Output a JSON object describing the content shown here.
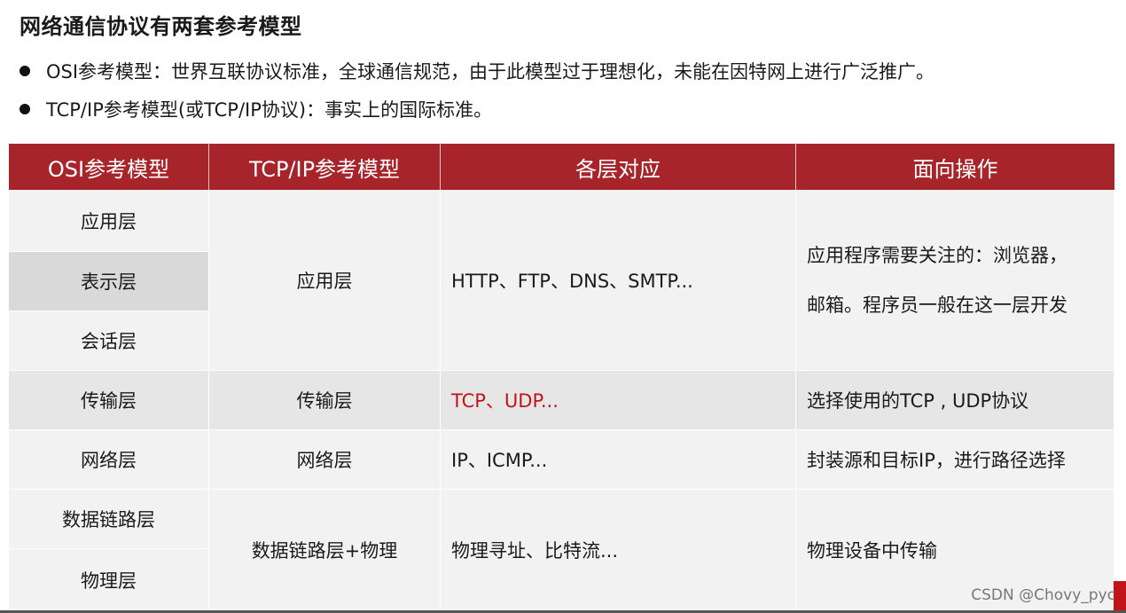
{
  "heading": "网络通信协议有两套参考模型",
  "bullets": [
    "OSI参考模型：世界互联协议标准，全球通信规范，由于此模型过于理想化，未能在因特网上进行广泛推广。",
    "TCP/IP参考模型(或TCP/IP协议)：事实上的国际标准。"
  ],
  "table": {
    "headers": [
      "OSI参考模型",
      "TCP/IP参考模型",
      "各层对应",
      "面向操作"
    ],
    "osi_layers": [
      "应用层",
      "表示层",
      "会话层",
      "传输层",
      "网络层",
      "数据链路层",
      "物理层"
    ],
    "tcpip_layers": [
      "应用层",
      "传输层",
      "网络层",
      "数据链路层+物理"
    ],
    "protocols": [
      "HTTP、FTP、DNS、SMTP...",
      "TCP、UDP...",
      "IP、ICMP...",
      "物理寻址、比特流..."
    ],
    "operations": [
      [
        "应用程序需要关注的：浏览器，",
        "邮箱。程序员一般在这一层开发"
      ],
      "选择使用的TCP , UDP协议",
      "封装源和目标IP，进行路径选择",
      "物理设备中传输"
    ]
  },
  "watermark": "CSDN @Chovy_pyc",
  "colors": {
    "header_bg": "#a6242a",
    "highlight_text": "#c0141a"
  }
}
